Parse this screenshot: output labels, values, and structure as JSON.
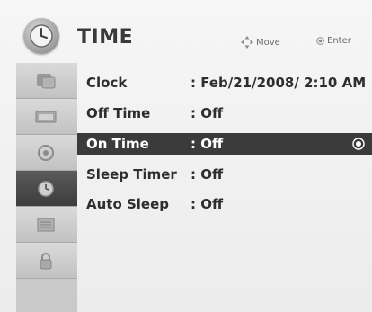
{
  "header": {
    "title": "TIME",
    "move_label": "Move",
    "enter_label": "Enter",
    "move_icon": "four-way-arrows-icon",
    "enter_icon": "ok-dot-icon",
    "badge_icon": "clock-icon"
  },
  "sidebar": {
    "items": [
      {
        "icon": "setup-icon"
      },
      {
        "icon": "picture-icon"
      },
      {
        "icon": "audio-icon"
      },
      {
        "icon": "time-icon",
        "active": true
      },
      {
        "icon": "option-icon"
      },
      {
        "icon": "lock-icon"
      }
    ]
  },
  "menu": {
    "rows": [
      {
        "label": "Clock",
        "value": ": Feb/21/2008/  2:10 AM"
      },
      {
        "label": "Off Time",
        "value": ": Off"
      },
      {
        "label": "On Time",
        "value": ": Off",
        "selected": true
      },
      {
        "label": "Sleep Timer",
        "value": ": Off"
      },
      {
        "label": "Auto Sleep",
        "value": ": Off"
      }
    ]
  },
  "colors": {
    "background": "#efefef",
    "selected_row": "#3b3b3b",
    "sidebar": "#c9c9c9",
    "active_sidebar": "#4a4a4a",
    "text": "#2e2e2e"
  }
}
